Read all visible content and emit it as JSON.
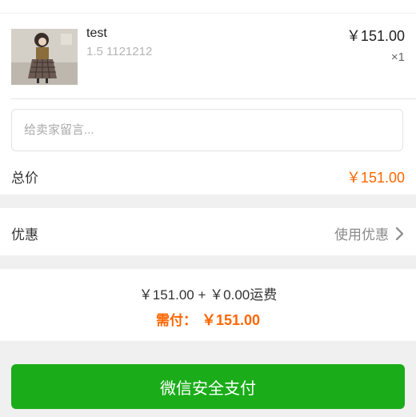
{
  "product": {
    "title": "test",
    "sku": "1.5 1121212",
    "price": "￥151.00",
    "quantity": "×1"
  },
  "message": {
    "placeholder": "给卖家留言..."
  },
  "total": {
    "label": "总价",
    "value": "￥151.00"
  },
  "discount": {
    "label": "优惠",
    "action_label": "使用优惠"
  },
  "summary": {
    "breakdown": "￥151.00 + ￥0.00运费",
    "due_label": "需付：",
    "due_value": "￥151.00"
  },
  "pay_button": {
    "label": "微信安全支付"
  },
  "colors": {
    "accent": "#ff6600",
    "primary": "#1aad19"
  }
}
